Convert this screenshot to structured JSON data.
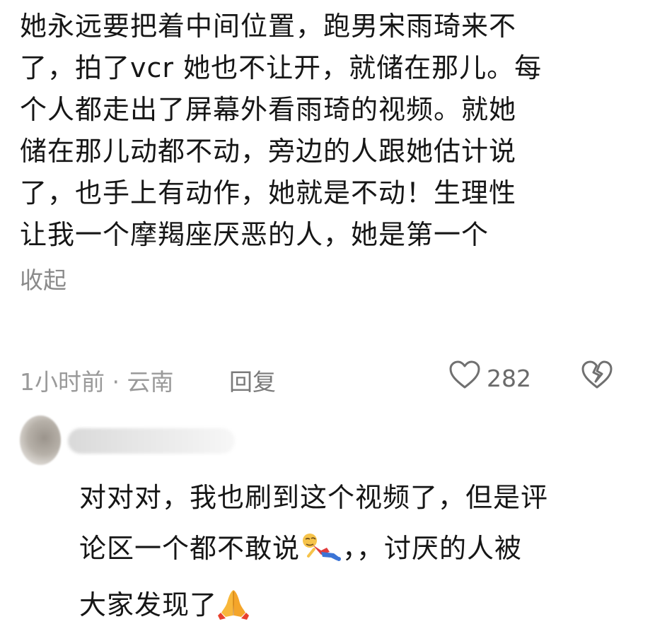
{
  "main_comment": {
    "lines": [
      "她永远要把着中间位置，跑男宋雨琦来不",
      "了，拍了vcr 她也不让开，就储在那儿。每",
      "个人都走出了屏幕外看雨琦的视频。就她",
      "储在那儿动都不动，旁边的人跟她估计说",
      "了，也手上有动作，她就是不动！生理性",
      "让我一个摩羯座厌恶的人，她是第一个"
    ],
    "collapse_label": "收起"
  },
  "meta": {
    "time_location": "1小时前 · 云南",
    "reply_label": "回复",
    "like_count": "282"
  },
  "reply": {
    "line1": "对对对，我也刷到这个视频了，但是评",
    "line2_a": "论区一个都不敢说",
    "line2_b": "，，讨厌的人被",
    "line3": "大家发现了"
  },
  "icons": {
    "like": "heart-outline-icon",
    "dislike": "broken-heart-icon",
    "emoji_1": "fallen-person-emoji",
    "emoji_2": "folded-hands-emoji"
  },
  "colors": {
    "text": "#161616",
    "meta": "#9a9a9a",
    "icon": "#7a7a7a"
  }
}
